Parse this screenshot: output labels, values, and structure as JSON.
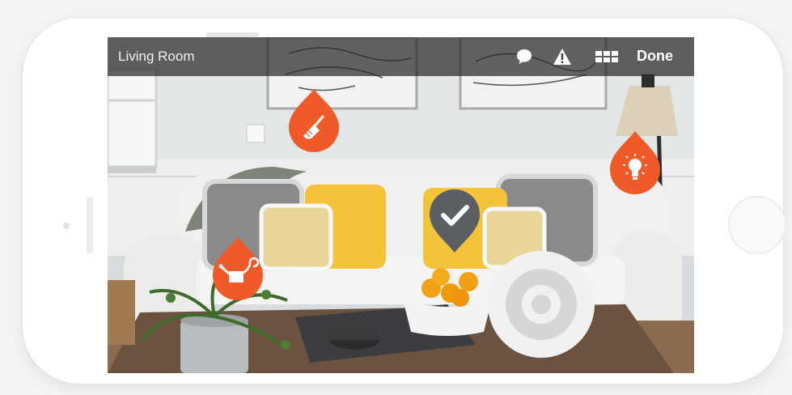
{
  "header": {
    "room_title": "Living Room",
    "done_label": "Done"
  },
  "toolbar_icons": [
    "chat-bubble-icon",
    "warning-icon",
    "grid-icon"
  ],
  "markers": [
    {
      "name": "broom-marker",
      "icon": "broom-icon",
      "color": "#f05a28"
    },
    {
      "name": "lightbulb-marker",
      "icon": "lightbulb-icon",
      "color": "#f05a28"
    },
    {
      "name": "checkmark-marker",
      "icon": "checkmark-icon",
      "color": "#5a5f63"
    },
    {
      "name": "watering-can-marker",
      "icon": "watering-can-icon",
      "color": "#f05a28"
    }
  ],
  "colors": {
    "accent": "#f05a28",
    "completed": "#5a5f63",
    "bar": "#282828"
  }
}
